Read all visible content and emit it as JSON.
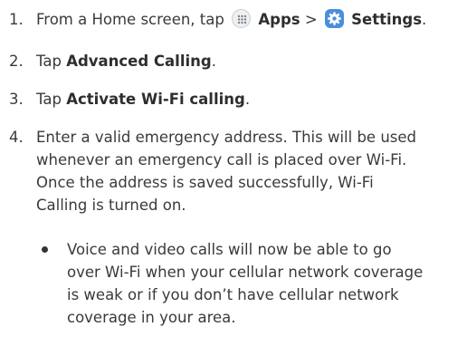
{
  "steps": [
    {
      "number": "1.",
      "prefix": "From a Home screen, tap",
      "apps_label": "Apps",
      "separator": ">",
      "settings_label": "Settings",
      "suffix": "."
    },
    {
      "number": "2.",
      "prefix": "Tap",
      "bold": "Advanced Calling",
      "suffix": "."
    },
    {
      "number": "3.",
      "prefix": "Tap",
      "bold": "Activate Wi-Fi calling",
      "suffix": "."
    },
    {
      "number": "4.",
      "lines": [
        "Enter a valid emergency address. This will be used",
        "whenever an emergency call is placed over Wi-Fi.",
        "Once the address is saved successfully, Wi-Fi",
        "Calling is turned on."
      ]
    }
  ],
  "bullet": {
    "lines": [
      "Voice and video calls will now be able to go",
      "over Wi-Fi when your cellular network coverage",
      "is weak or if you don’t have cellular network",
      "coverage in your area."
    ]
  },
  "icons": {
    "apps": "apps-grid-icon",
    "settings": "gear-icon"
  },
  "colors": {
    "text": "#3a3a3a",
    "settings_icon_bg": "#4a8fdc"
  }
}
